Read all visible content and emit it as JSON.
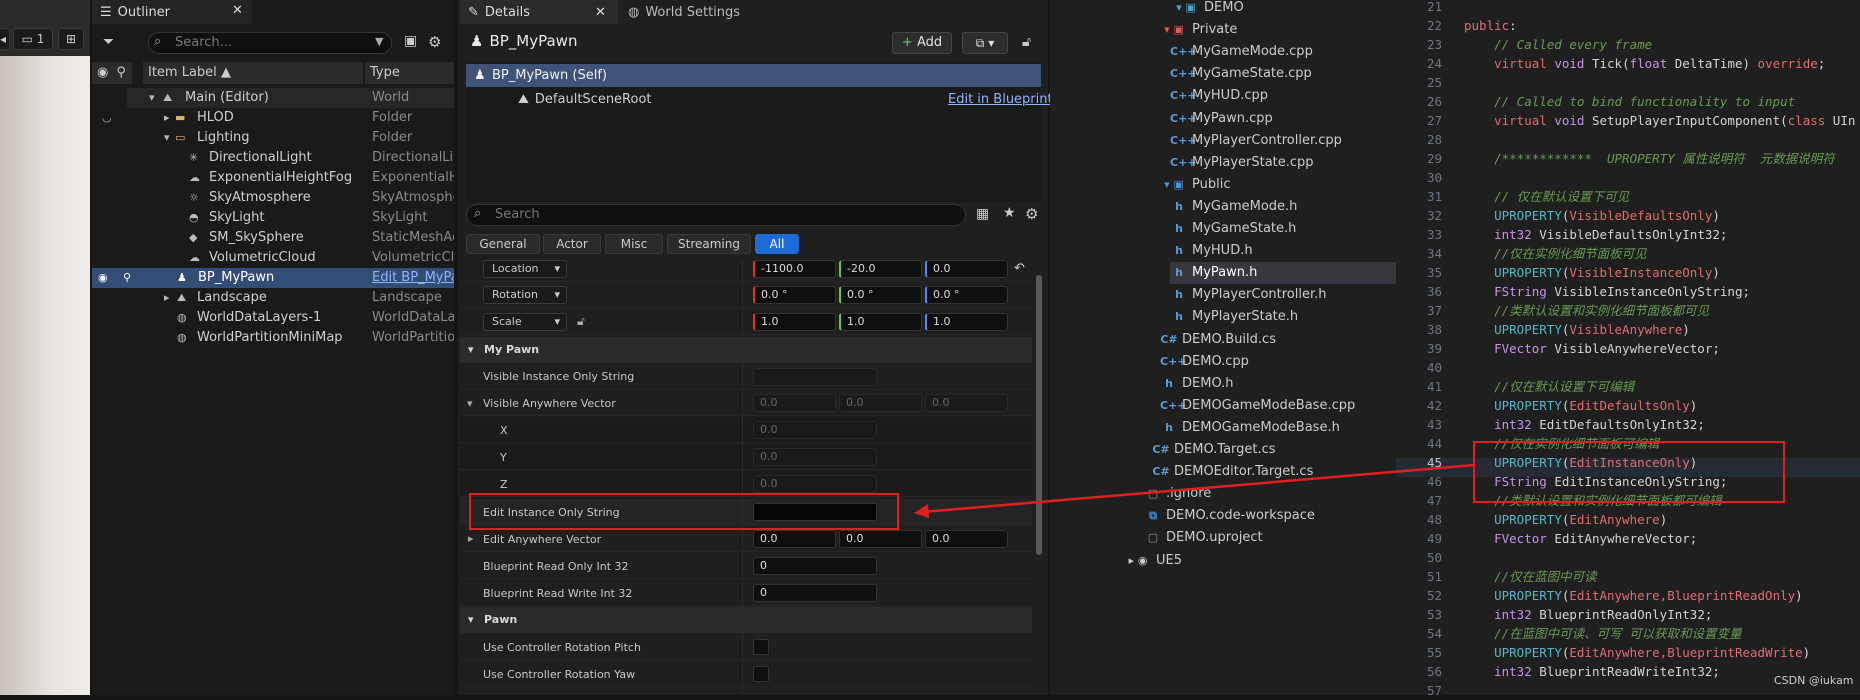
{
  "viewport": {
    "camera_speed": "1"
  },
  "outliner": {
    "tab_title": "Outliner",
    "search_placeholder": "Search...",
    "col_label": "Item Label",
    "col_type": "Type",
    "rows": [
      {
        "label": "Main (Editor)",
        "type": "World"
      },
      {
        "label": "HLOD",
        "type": "Folder"
      },
      {
        "label": "Lighting",
        "type": "Folder"
      },
      {
        "label": "DirectionalLight",
        "type": "DirectionalLigh"
      },
      {
        "label": "ExponentialHeightFog",
        "type": "ExponentialHe"
      },
      {
        "label": "SkyAtmosphere",
        "type": "SkyAtmosphe"
      },
      {
        "label": "SkyLight",
        "type": "SkyLight"
      },
      {
        "label": "SM_SkySphere",
        "type": "StaticMeshAct"
      },
      {
        "label": "VolumetricCloud",
        "type": "VolumetricClo"
      },
      {
        "label": "BP_MyPawn",
        "type": "Edit BP_MyPa"
      },
      {
        "label": "Landscape",
        "type": "Landscape"
      },
      {
        "label": "WorldDataLayers-1",
        "type": "WorldDataLay"
      },
      {
        "label": "WorldPartitionMiniMap",
        "type": "WorldPartition"
      }
    ]
  },
  "details": {
    "tab_title": "Details",
    "world_settings_tab": "World Settings",
    "object_name": "BP_MyPawn",
    "add_label": "Add",
    "self_item": "BP_MyPawn (Self)",
    "root_item": "DefaultSceneRoot",
    "edit_in_blueprint": "Edit in Blueprint",
    "search_placeholder": "Search",
    "filter_tabs": [
      "General",
      "Actor",
      "Misc",
      "Streaming",
      "All"
    ],
    "transform": {
      "location_label": "Location",
      "location": [
        "-1100.0",
        "-20.0",
        "0.0"
      ],
      "rotation_label": "Rotation",
      "rotation": [
        "0.0 °",
        "0.0 °",
        "0.0 °"
      ],
      "scale_label": "Scale",
      "scale": [
        "1.0",
        "1.0",
        "1.0"
      ]
    },
    "section_mypawn": "My Pawn",
    "props": {
      "visible_instance_only_string": "Visible Instance Only String",
      "visible_anywhere_vector": "Visible Anywhere Vector",
      "vav_values": [
        "0.0",
        "0.0",
        "0.0"
      ],
      "x_label": "X",
      "x_value": "0.0",
      "y_label": "Y",
      "y_value": "0.0",
      "z_label": "Z",
      "z_value": "0.0",
      "edit_instance_only_string": "Edit Instance Only String",
      "edit_anywhere_vector": "Edit Anywhere Vector",
      "eav_values": [
        "0.0",
        "0.0",
        "0.0"
      ],
      "bp_read_only": "Blueprint Read Only Int 32",
      "bp_read_only_value": "0",
      "bp_read_write": "Blueprint Read Write Int 32",
      "bp_read_write_value": "0"
    },
    "section_pawn": "Pawn",
    "pawn_props": {
      "pitch": "Use Controller Rotation Pitch",
      "yaw": "Use Controller Rotation Yaw"
    }
  },
  "explorer": {
    "root": "DEMO",
    "private": "Private",
    "private_files": [
      "MyGameMode.cpp",
      "MyGameState.cpp",
      "MyHUD.cpp",
      "MyPawn.cpp",
      "MyPlayerController.cpp",
      "MyPlayerState.cpp"
    ],
    "public": "Public",
    "public_files": [
      "MyGameMode.h",
      "MyGameState.h",
      "MyHUD.h",
      "MyPawn.h",
      "MyPlayerController.h",
      "MyPlayerState.h"
    ],
    "demo_files": [
      "DEMO.Build.cs",
      "DEMO.cpp",
      "DEMO.h",
      "DEMOGameModeBase.cpp",
      "DEMOGameModeBase.h"
    ],
    "source_files": [
      "DEMO.Target.cs",
      "DEMOEditor.Target.cs"
    ],
    "root_files": [
      ".ignore",
      "DEMO.code-workspace",
      "DEMO.uproject"
    ],
    "ue5": "UE5"
  },
  "code": {
    "lines": [
      {
        "n": "21",
        "t": ""
      },
      {
        "n": "22",
        "t": "public:"
      },
      {
        "n": "23",
        "t": "    // Called every frame"
      },
      {
        "n": "24",
        "t": "    virtual void Tick(float DeltaTime) override;"
      },
      {
        "n": "25",
        "t": ""
      },
      {
        "n": "26",
        "t": "    // Called to bind functionality to input"
      },
      {
        "n": "27",
        "t": "    virtual void SetupPlayerInputComponent(class UIn"
      },
      {
        "n": "28",
        "t": ""
      },
      {
        "n": "29",
        "t": "    /************  UPROPERTY 属性说明符  元数据说明符"
      },
      {
        "n": "30",
        "t": ""
      },
      {
        "n": "31",
        "t": "    // 仅在默认设置下可见"
      },
      {
        "n": "32",
        "t": "    UPROPERTY(VisibleDefaultsOnly)"
      },
      {
        "n": "33",
        "t": "    int32 VisibleDefaultsOnlyInt32;"
      },
      {
        "n": "34",
        "t": "    //仅在实例化细节面板可见"
      },
      {
        "n": "35",
        "t": "    UPROPERTY(VisibleInstanceOnly)"
      },
      {
        "n": "36",
        "t": "    FString VisibleInstanceOnlyString;"
      },
      {
        "n": "37",
        "t": "    //类默认设置和实例化细节面板都可见"
      },
      {
        "n": "38",
        "t": "    UPROPERTY(VisibleAnywhere)"
      },
      {
        "n": "39",
        "t": "    FVector VisibleAnywhereVector;"
      },
      {
        "n": "40",
        "t": ""
      },
      {
        "n": "41",
        "t": "    //仅在默认设置下可编辑"
      },
      {
        "n": "42",
        "t": "    UPROPERTY(EditDefaultsOnly)"
      },
      {
        "n": "43",
        "t": "    int32 EditDefaultsOnlyInt32;"
      },
      {
        "n": "44",
        "t": "    //仅在实例化细节面板可编辑"
      },
      {
        "n": "45",
        "t": "    UPROPERTY(EditInstanceOnly)"
      },
      {
        "n": "46",
        "t": "    FString EditInstanceOnlyString;"
      },
      {
        "n": "47",
        "t": "    //类默认设置和实例化细节面板都可编辑"
      },
      {
        "n": "48",
        "t": "    UPROPERTY(EditAnywhere)"
      },
      {
        "n": "49",
        "t": "    FVector EditAnywhereVector;"
      },
      {
        "n": "50",
        "t": ""
      },
      {
        "n": "51",
        "t": "    //仅在蓝图中可读"
      },
      {
        "n": "52",
        "t": "    UPROPERTY(EditAnywhere,BlueprintReadOnly)"
      },
      {
        "n": "53",
        "t": "    int32 BlueprintReadOnlyInt32;"
      },
      {
        "n": "54",
        "t": "    //在蓝图中可读、可写 可以获取和设置变量"
      },
      {
        "n": "55",
        "t": "    UPROPERTY(EditAnywhere,BlueprintReadWrite)"
      },
      {
        "n": "56",
        "t": "    int32 BlueprintReadWriteInt32;"
      },
      {
        "n": "57",
        "t": ""
      }
    ]
  },
  "watermark": "CSDN @iukam",
  "colors": {
    "accent": "#1e6bd6",
    "selection": "#334d75",
    "annotation": "#e02020"
  }
}
